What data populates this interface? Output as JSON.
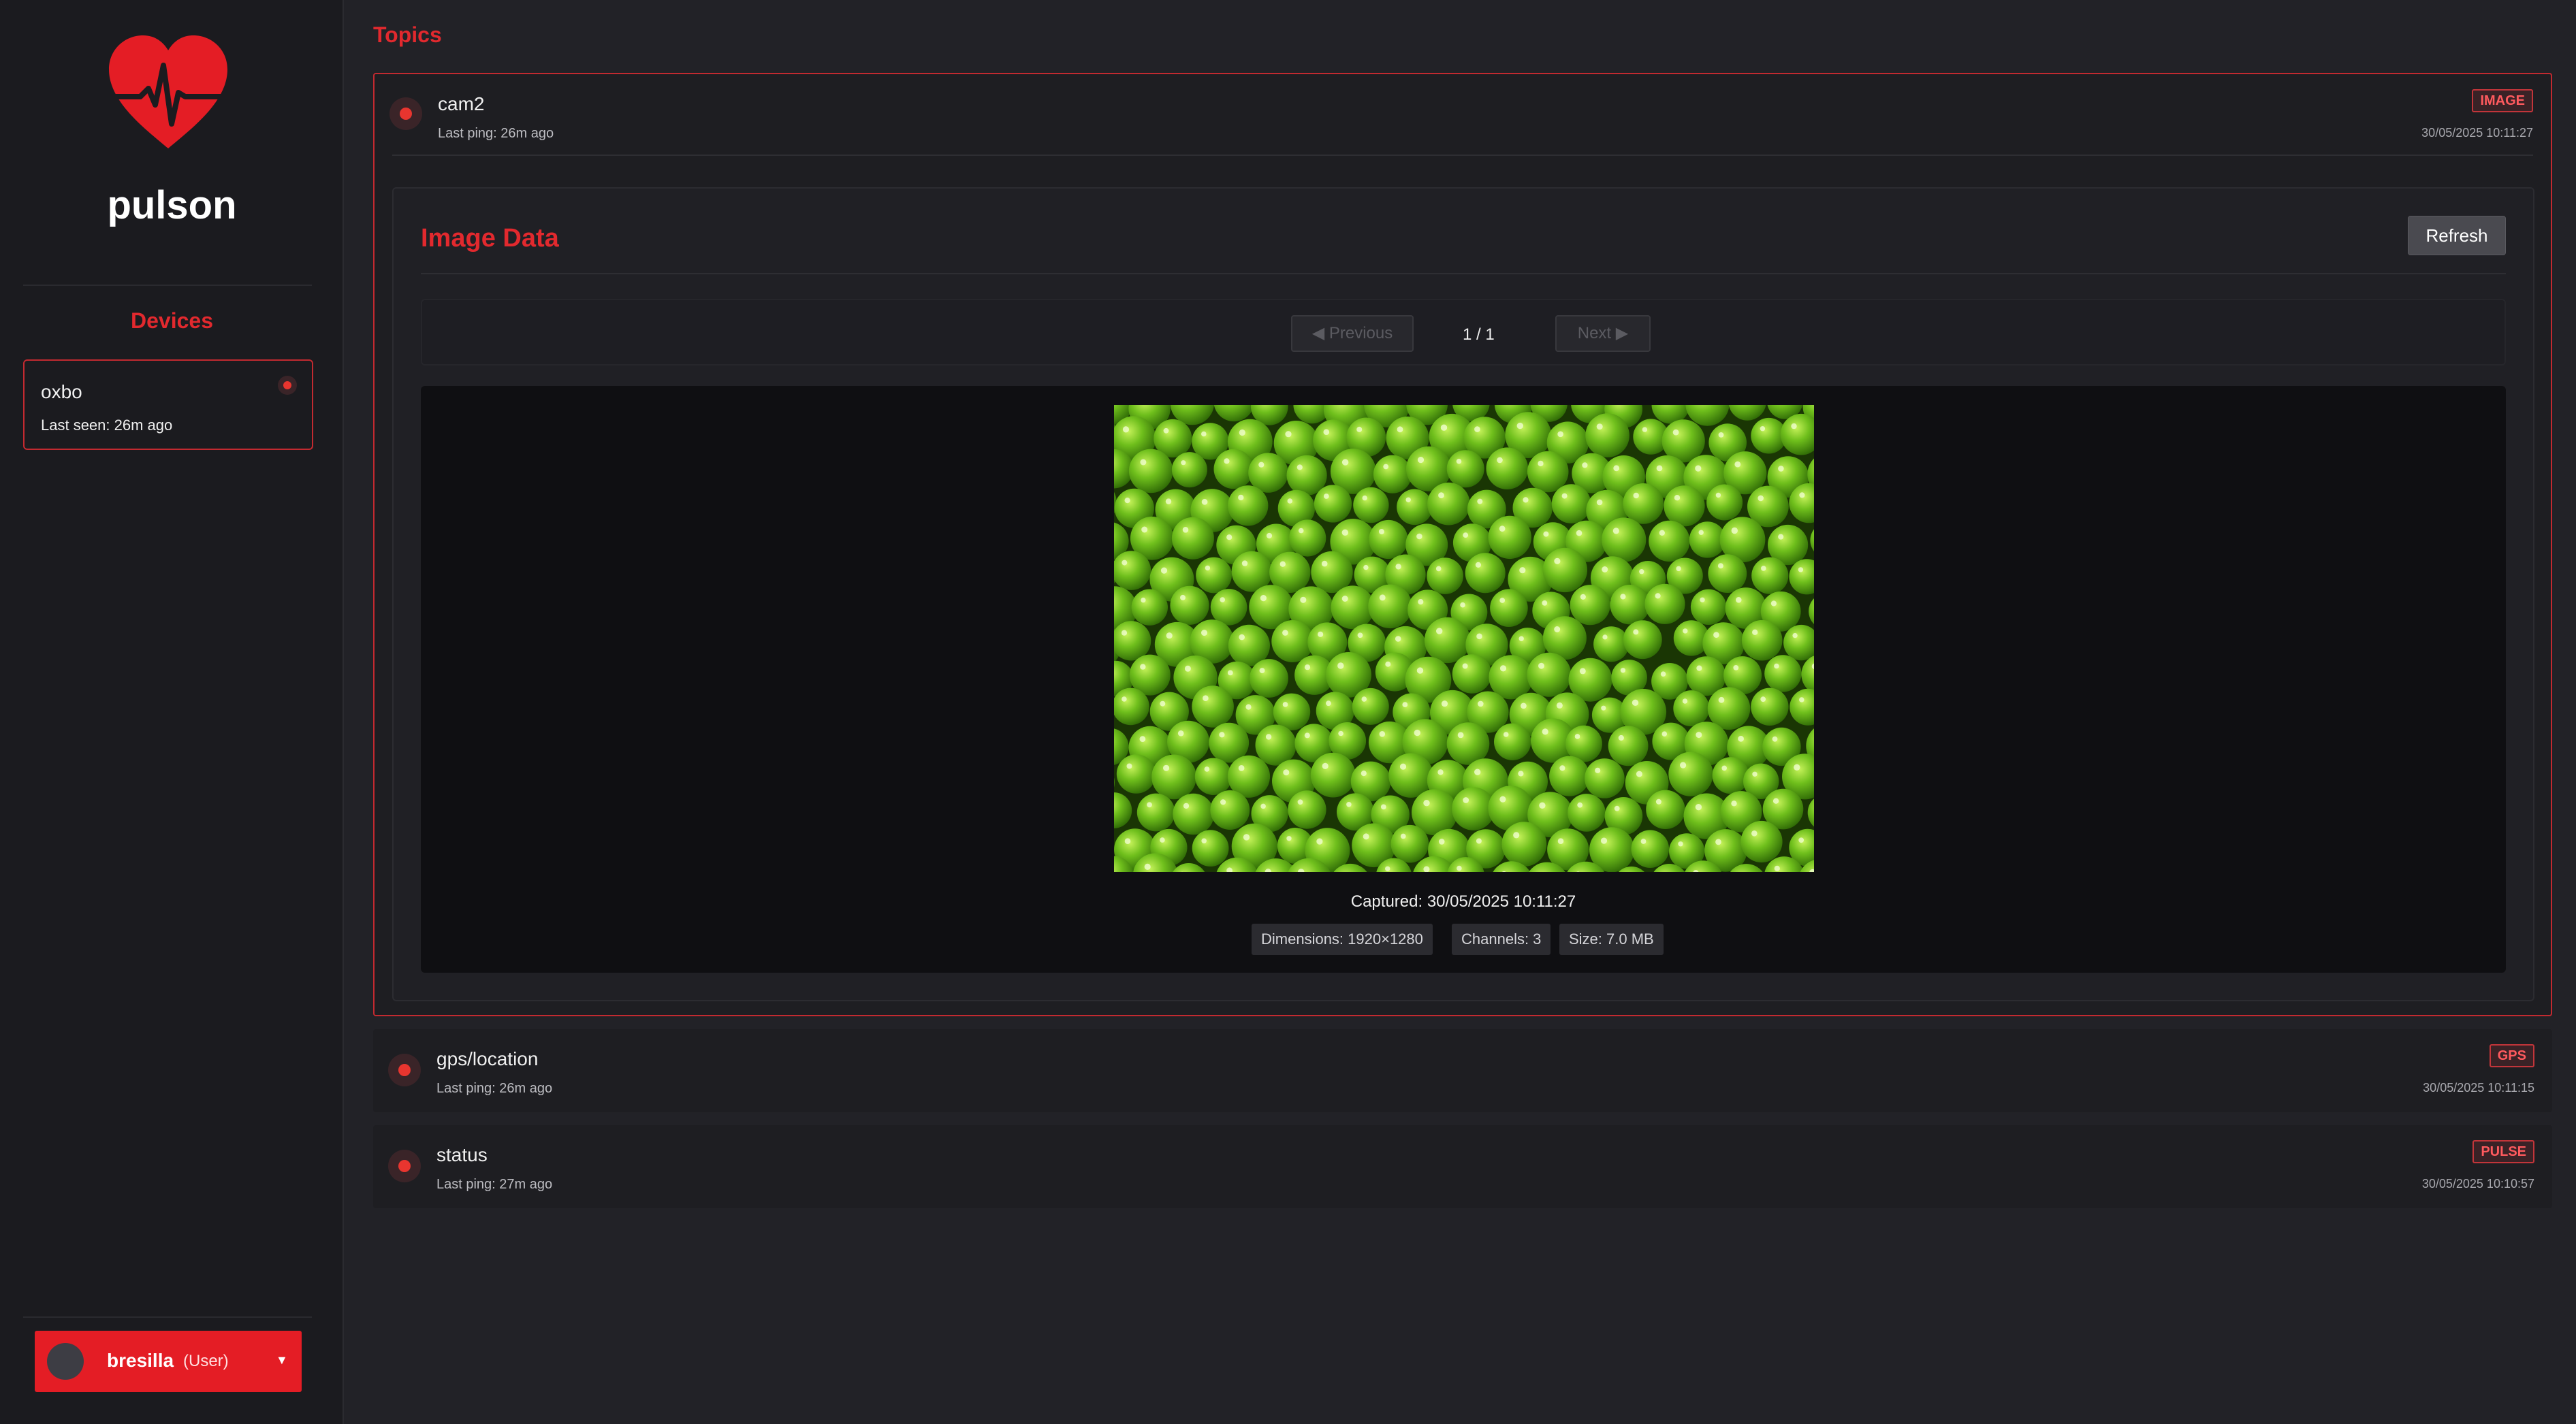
{
  "app": {
    "brand": "pulson"
  },
  "sidebar": {
    "devices_title": "Devices",
    "devices": [
      {
        "name": "oxbo",
        "last_seen": "Last seen: 26m ago"
      }
    ],
    "user": {
      "name": "bresilla",
      "role": "(User)",
      "caret": "▼"
    }
  },
  "main": {
    "topics_title": "Topics",
    "topics": [
      {
        "name": "cam2",
        "ping": "Last ping: 26m ago",
        "badge": "IMAGE",
        "time": "30/05/2025 10:11:27"
      },
      {
        "name": "gps/location",
        "ping": "Last ping: 26m ago",
        "badge": "GPS",
        "time": "30/05/2025 10:11:15"
      },
      {
        "name": "status",
        "ping": "Last ping: 27m ago",
        "badge": "PULSE",
        "time": "30/05/2025 10:10:57"
      }
    ],
    "image_panel": {
      "title": "Image Data",
      "refresh_label": "Refresh",
      "prev_label": "◀ Previous",
      "next_label": "Next ▶",
      "page_count": "1 / 1",
      "captured": "Captured: 30/05/2025 10:11:27",
      "dimensions": "Dimensions: 1920×1280",
      "channels": "Channels: 3",
      "size": "Size: 7.0 MB"
    }
  },
  "colors": {
    "accent": "#e2292e",
    "sidebar_bg": "#1b1b1f",
    "main_bg": "#222227",
    "status_dot": "#e8352f"
  },
  "icons": {
    "logo": "heart-pulse-icon",
    "status": "status-dot-icon",
    "avatar": "avatar-circle"
  }
}
